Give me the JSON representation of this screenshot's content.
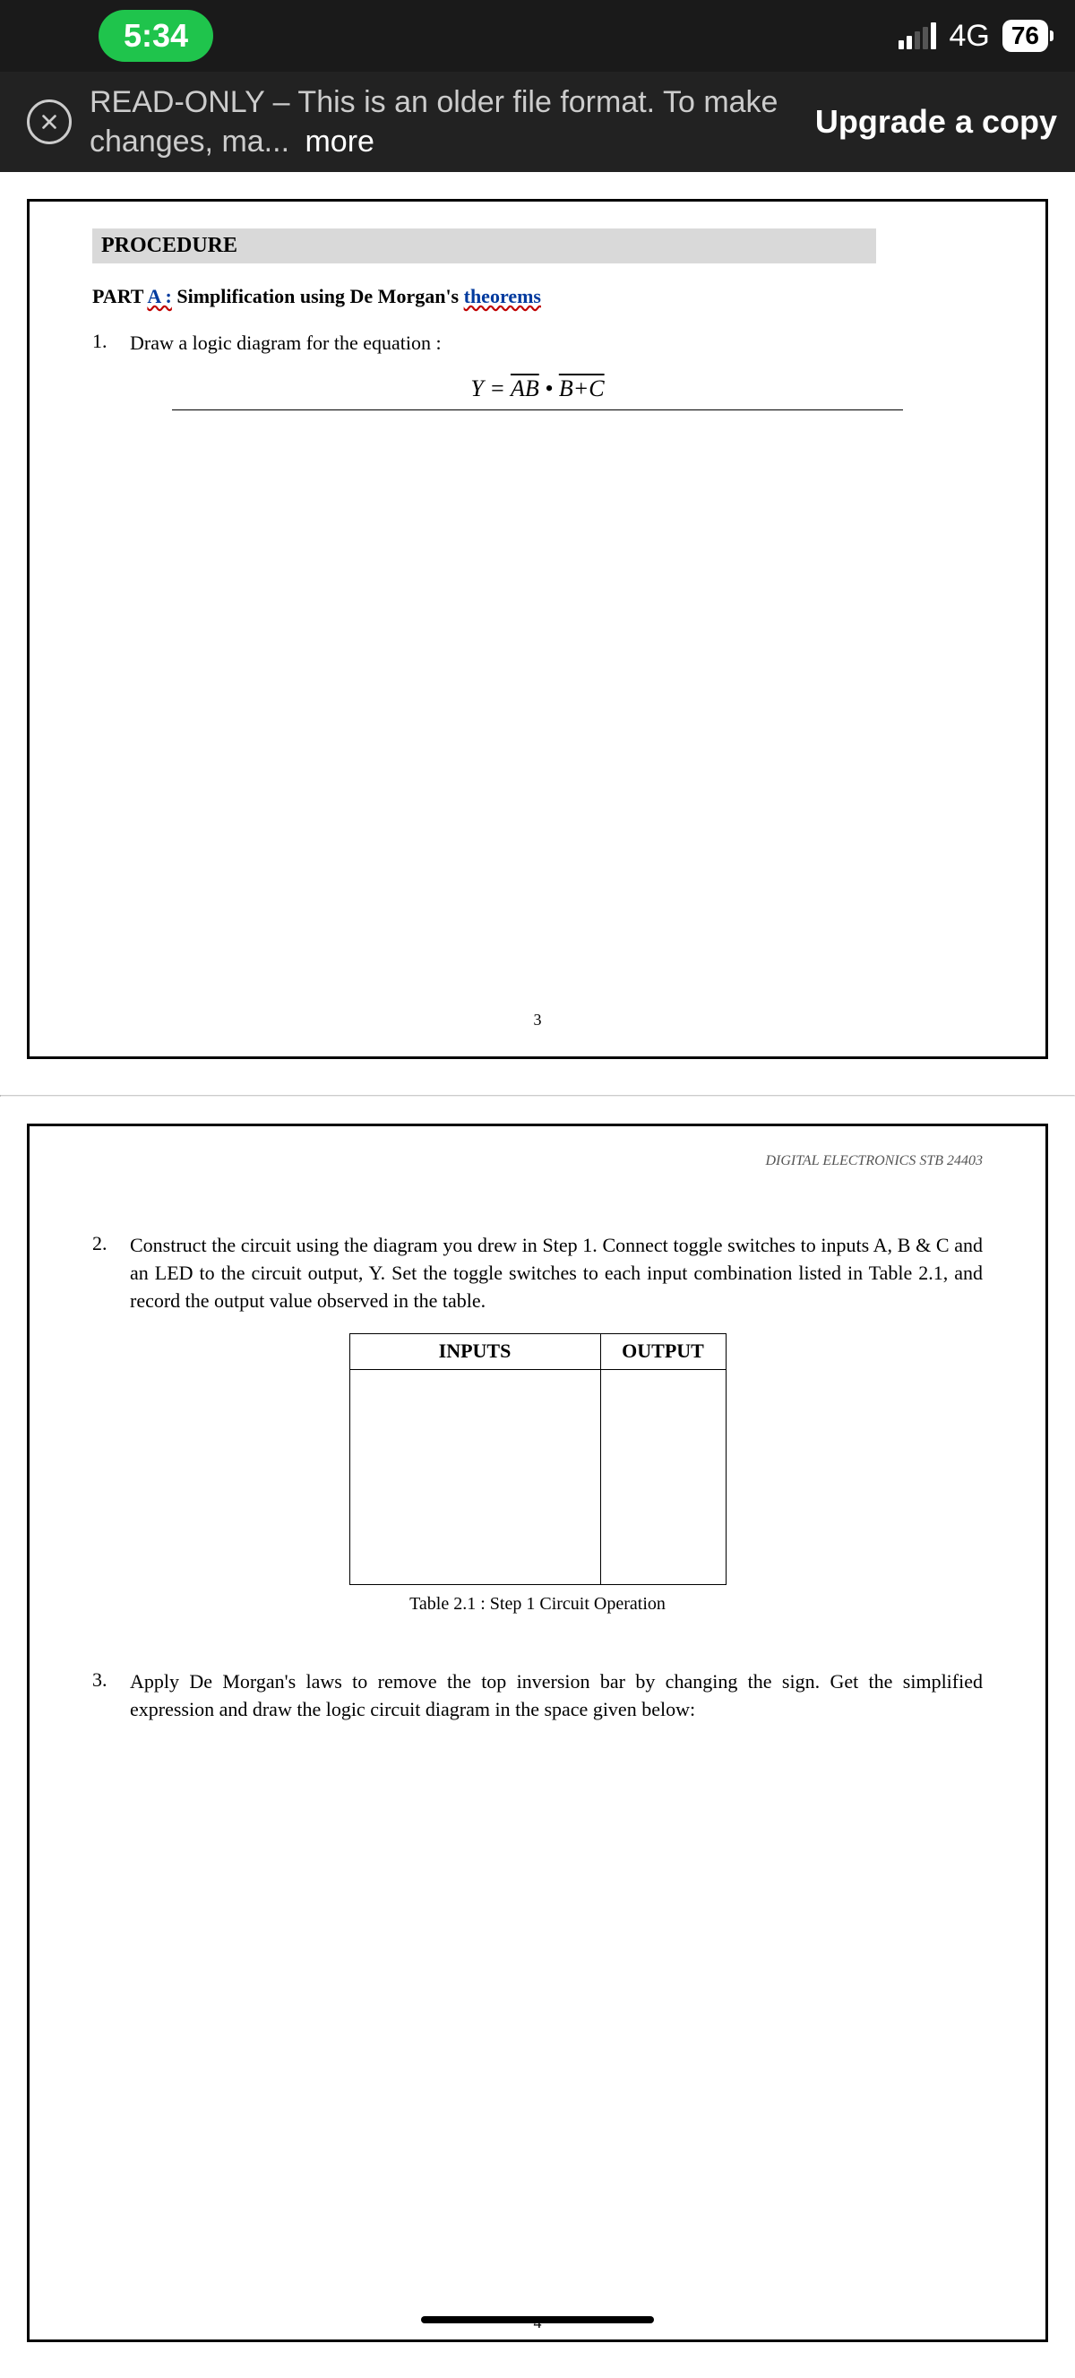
{
  "status": {
    "time": "5:34",
    "network": "4G",
    "battery": "76"
  },
  "banner": {
    "prefix": "READ-ONLY",
    "message": " – This is an older file format. To make changes, ma...",
    "more": "more",
    "upgrade": "Upgrade a copy"
  },
  "page1": {
    "procedure": "PROCEDURE",
    "part_label": "PART ",
    "part_a": "A :",
    "part_title": " Simplification using De Morgan's ",
    "part_link": "theorems",
    "step1_num": "1.",
    "step1_text_a": "Draw a logic diagram for the ",
    "step1_link": "equation :",
    "eq_left": "Y = ",
    "eq_t1": "AB",
    "eq_dot": " • ",
    "eq_t2": "B+C",
    "page_num": "3"
  },
  "page2": {
    "header": "DIGITAL ELECTRONICS STB 24403",
    "step2_num": "2.",
    "step2_text": "Construct the circuit using the diagram you drew in Step 1. Connect toggle switches to inputs A, B & C and an LED to the circuit output, Y. Set the toggle switches to each input combination listed in Table 2.1, and record the output value observed in the table.",
    "th_inputs": "INPUTS",
    "th_output": "OUTPUT",
    "caption": "Table 2.1 : Step 1 Circuit Operation",
    "step3_num": "3.",
    "step3_text": "Apply De Morgan's laws to remove the top inversion bar by changing the sign. Get the simplified expression and draw the logic circuit diagram in the space given below:",
    "page_num": "4"
  }
}
